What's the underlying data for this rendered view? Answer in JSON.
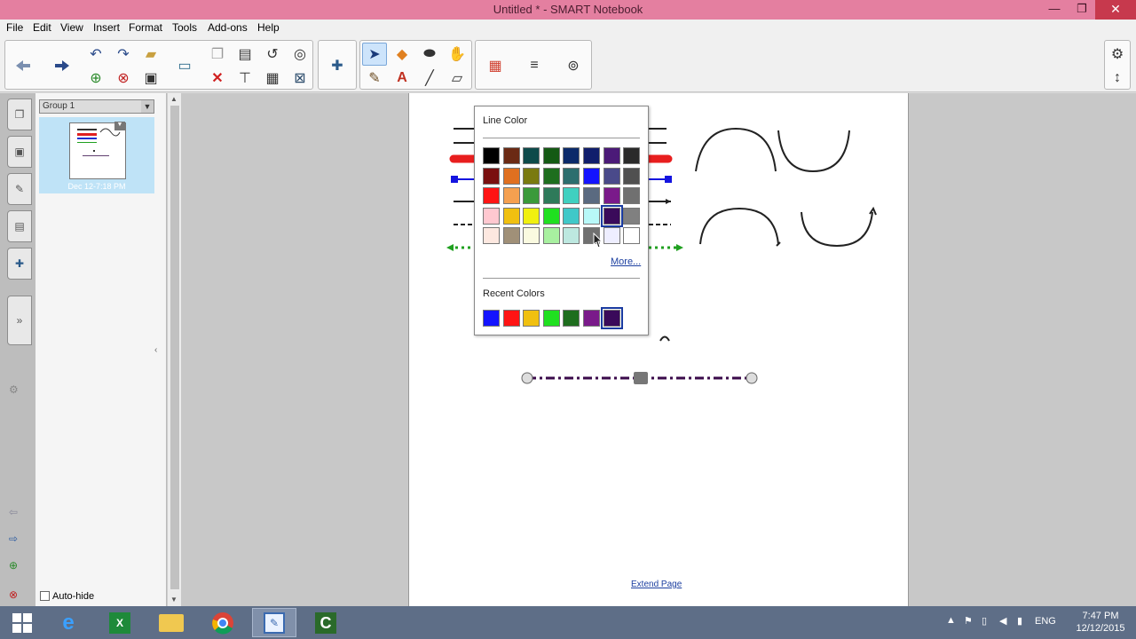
{
  "window": {
    "title": "Untitled * - SMART Notebook",
    "minimize": "—",
    "restore": "❐",
    "close": "✕"
  },
  "menu": [
    "File",
    "Edit",
    "View",
    "Insert",
    "Format",
    "Tools",
    "Add-ons",
    "Help"
  ],
  "sorter": {
    "group_label": "Group 1",
    "thumb_date": "Dec 12-7:18 PM",
    "autohide_label": "Auto-hide"
  },
  "page": {
    "extend_link": "Extend Page"
  },
  "line_color_popup": {
    "title": "Line Color",
    "more_link": "More...",
    "recent_title": "Recent Colors",
    "palette": [
      [
        "#000000",
        "#6b2a14",
        "#0d4a4a",
        "#145a14",
        "#0b2a6a",
        "#101e6c",
        "#4b1a78",
        "#2a2a2a"
      ],
      [
        "#7a1010",
        "#e07020",
        "#7a7a10",
        "#1e6e1e",
        "#2c6e6e",
        "#1414ff",
        "#4a4a8a",
        "#505050"
      ],
      [
        "#ff1414",
        "#f5a050",
        "#3a9a3a",
        "#2e7a5a",
        "#40d0c0",
        "#5a6a80",
        "#7a1a8a",
        "#707070"
      ],
      [
        "#ffc8d0",
        "#f0c010",
        "#f0f010",
        "#20e020",
        "#40c8c8",
        "#b8f8f8",
        "#3a0a5a",
        "#808080"
      ],
      [
        "#fde8e0",
        "#a09078",
        "#fafae0",
        "#a8f0a0",
        "#bde8e0",
        "#707070",
        "#eeeeff",
        "#ffffff"
      ]
    ],
    "selected": [
      3,
      6
    ],
    "recent": [
      "#1414ff",
      "#ff1414",
      "#f0c010",
      "#20e020",
      "#1e6e1e",
      "#7a1a8a",
      "#3a0a5a"
    ],
    "recent_selected": 6
  },
  "taskbar": {
    "lang": "ENG",
    "time": "7:47 PM",
    "date": "12/12/2015"
  },
  "icons": {
    "back": "left-arrow-icon",
    "forward": "right-arrow-icon"
  }
}
